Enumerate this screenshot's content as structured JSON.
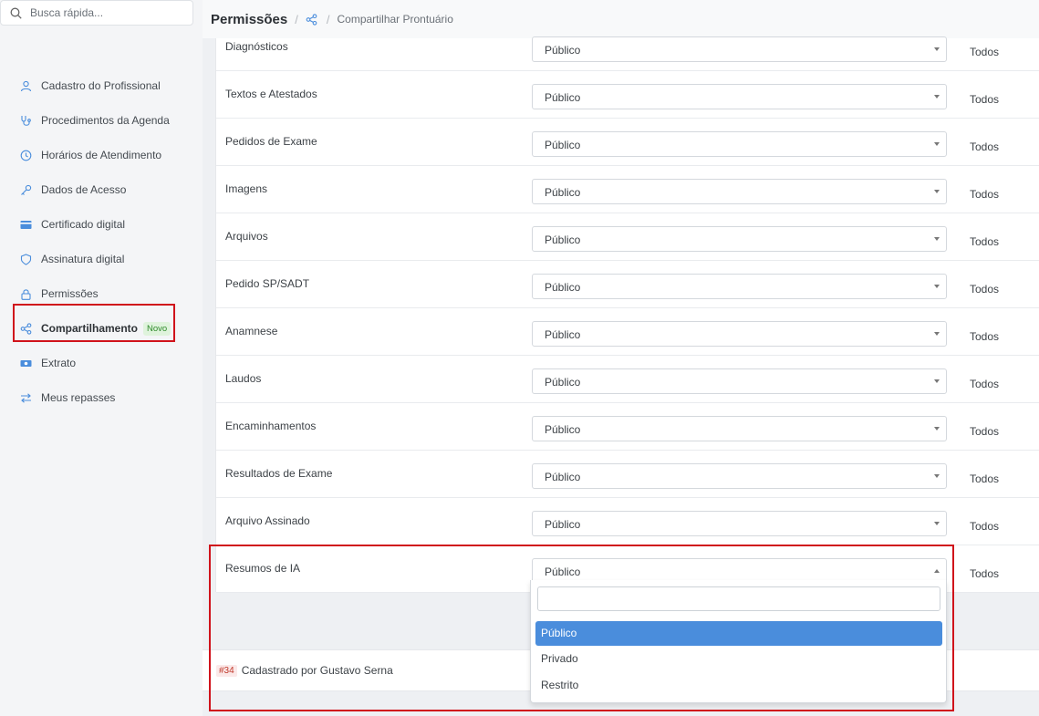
{
  "search": {
    "placeholder": "Busca rápida..."
  },
  "sidebar": {
    "items": [
      {
        "label": "Cadastro do Profissional",
        "icon": "user-icon"
      },
      {
        "label": "Procedimentos da Agenda",
        "icon": "stethoscope-icon"
      },
      {
        "label": "Horários de Atendimento",
        "icon": "clock-icon"
      },
      {
        "label": "Dados de Acesso",
        "icon": "key-icon"
      },
      {
        "label": "Certificado digital",
        "icon": "credit-card-icon"
      },
      {
        "label": "Assinatura digital",
        "icon": "shield-icon"
      },
      {
        "label": "Permissões",
        "icon": "lock-icon"
      },
      {
        "label": "Compartilhamento",
        "icon": "share-icon",
        "badge": "Novo"
      },
      {
        "label": "Extrato",
        "icon": "money-icon"
      },
      {
        "label": "Meus repasses",
        "icon": "transfer-icon"
      }
    ]
  },
  "header": {
    "title": "Permissões",
    "separator": "/",
    "crumb": "Compartilhar Prontuário"
  },
  "rows": [
    {
      "label": "Diagnósticos",
      "value": "Público",
      "scope": "Todos"
    },
    {
      "label": "Textos e Atestados",
      "value": "Público",
      "scope": "Todos"
    },
    {
      "label": "Pedidos de Exame",
      "value": "Público",
      "scope": "Todos"
    },
    {
      "label": "Imagens",
      "value": "Público",
      "scope": "Todos"
    },
    {
      "label": "Arquivos",
      "value": "Público",
      "scope": "Todos"
    },
    {
      "label": "Pedido SP/SADT",
      "value": "Público",
      "scope": "Todos"
    },
    {
      "label": "Anamnese",
      "value": "Público",
      "scope": "Todos"
    },
    {
      "label": "Laudos",
      "value": "Público",
      "scope": "Todos"
    },
    {
      "label": "Encaminhamentos",
      "value": "Público",
      "scope": "Todos"
    },
    {
      "label": "Resultados de Exame",
      "value": "Público",
      "scope": "Todos"
    },
    {
      "label": "Arquivo Assinado",
      "value": "Público",
      "scope": "Todos"
    },
    {
      "label": "Resumos de IA",
      "value": "Público",
      "scope": "Todos"
    }
  ],
  "dropdown": {
    "search_value": "",
    "options": [
      "Público",
      "Privado",
      "Restrito"
    ],
    "selected": "Público"
  },
  "footer": {
    "id": "#34",
    "text": "Cadastrado por Gustavo Serna"
  },
  "colors": {
    "accent": "#4a8ddc",
    "highlight": "#d0121b",
    "badge_bg": "#dff3dc",
    "badge_text": "#2e8a2a"
  }
}
